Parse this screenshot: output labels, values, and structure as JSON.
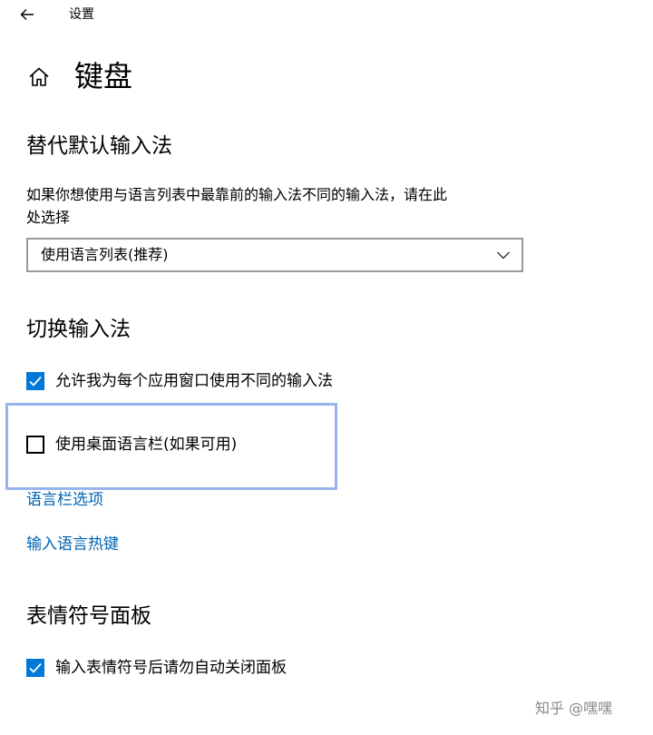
{
  "window": {
    "app_title": "设置"
  },
  "page": {
    "title": "键盘"
  },
  "sections": {
    "override_input": {
      "title": "替代默认输入法",
      "description_line1": "如果你想使用与语言列表中最靠前的输入法不同的输入法，请在此",
      "description_line2": "处选择",
      "dropdown_value": "使用语言列表(推荐)"
    },
    "switch_input": {
      "title": "切换输入法",
      "checkbox_per_app": {
        "label": "允许我为每个应用窗口使用不同的输入法",
        "checked": true
      },
      "checkbox_language_bar": {
        "label": "使用桌面语言栏(如果可用)",
        "checked": false
      },
      "link_language_bar_options": "语言栏选项",
      "link_input_hotkeys": "输入语言热键"
    },
    "emoji_panel": {
      "title": "表情符号面板",
      "checkbox_auto_close": {
        "label": "输入表情符号后请勿自动关闭面板",
        "checked": true
      }
    }
  },
  "watermark": "知乎 @嘿嘿",
  "colors": {
    "accent": "#0078d7",
    "link": "#0063b1",
    "focus_outline": "#98b4ed",
    "dropdown_border": "#999999"
  },
  "icons": {
    "back": "back-arrow-icon",
    "home": "home-icon",
    "dropdown": "chevron-down-icon",
    "check": "checkmark-icon"
  }
}
